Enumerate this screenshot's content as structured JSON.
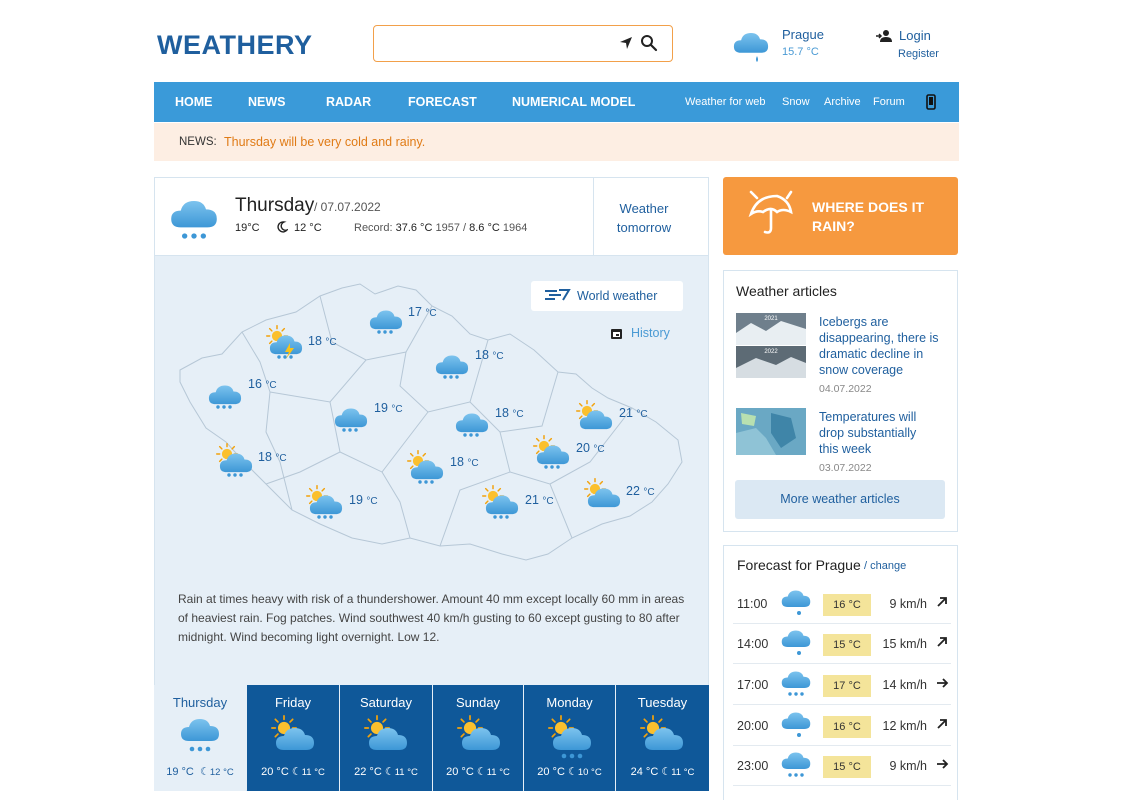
{
  "header": {
    "logo": "WEATHERY",
    "search_placeholder": "",
    "city": "Prague",
    "city_temp": "15.7 °C",
    "login": "Login",
    "register": "Register"
  },
  "nav": {
    "main": [
      "HOME",
      "NEWS",
      "RADAR",
      "FORECAST",
      "NUMERICAL MODEL"
    ],
    "secondary": [
      "Weather for web",
      "Snow",
      "Archive",
      "Forum"
    ]
  },
  "news": {
    "label": "NEWS:",
    "text": "Thursday will be very cold and rainy."
  },
  "today": {
    "day": "Thursday",
    "date": "/ 07.07.2022",
    "high": "19°C",
    "low": "12 °C",
    "record_label": "Record:",
    "record_high": "37.6 °C",
    "record_high_year": "1957 /",
    "record_low": "8.6 °C",
    "record_low_year": "1964",
    "tomorrow": "Weather tomorrow"
  },
  "map": {
    "world_weather": "World weather",
    "history": "History",
    "temps": [
      "17",
      "18",
      "18",
      "16",
      "19",
      "18",
      "21",
      "18",
      "18",
      "20",
      "19",
      "21",
      "22"
    ],
    "unit": "°C"
  },
  "description": "Rain at times heavy with risk of a thundershower. Amount 40 mm except locally 60 mm in areas of heaviest rain. Fog patches. Wind southwest 40 km/h gusting to 60 except gusting to 80 after midnight. Wind becoming light overnight. Low 12.",
  "days": [
    {
      "name": "Thursday",
      "hi": "19 °C",
      "lo": "12 °C",
      "icon": "rain-cloud-icon"
    },
    {
      "name": "Friday",
      "hi": "20 °C",
      "lo": "11 °C",
      "icon": "partly-cloudy-icon"
    },
    {
      "name": "Saturday",
      "hi": "22 °C",
      "lo": "11 °C",
      "icon": "partly-cloudy-icon"
    },
    {
      "name": "Sunday",
      "hi": "20 °C",
      "lo": "11 °C",
      "icon": "partly-cloudy-icon"
    },
    {
      "name": "Monday",
      "hi": "20 °C",
      "lo": "10 °C",
      "icon": "sun-rain-icon"
    },
    {
      "name": "Tuesday",
      "hi": "24 °C",
      "lo": "11 °C",
      "icon": "partly-cloudy-icon"
    }
  ],
  "rain_box": "WHERE DOES IT RAIN?",
  "articles": {
    "title": "Weather articles",
    "items": [
      {
        "title": "Icebergs are disappearing, there is dramatic decline in snow coverage",
        "date": "04.07.2022",
        "labels": [
          "2021",
          "2022"
        ]
      },
      {
        "title": "Temperatures will drop substantially this week",
        "date": "03.07.2022"
      }
    ],
    "more": "More weather articles"
  },
  "forecast": {
    "title": "Forecast for Prague",
    "change": "/ change",
    "rows": [
      {
        "time": "11:00",
        "temp": "16 °C",
        "wind": "9 km/h",
        "dir": "ne-arrow-icon"
      },
      {
        "time": "14:00",
        "temp": "15 °C",
        "wind": "15 km/h",
        "dir": "ne-arrow-icon"
      },
      {
        "time": "17:00",
        "temp": "17 °C",
        "wind": "14 km/h",
        "dir": "e-arrow-icon"
      },
      {
        "time": "20:00",
        "temp": "16 °C",
        "wind": "12 km/h",
        "dir": "ne-arrow-icon"
      },
      {
        "time": "23:00",
        "temp": "15 °C",
        "wind": "9 km/h",
        "dir": "e-arrow-icon"
      }
    ]
  },
  "colors": {
    "brand": "#1f5f9e",
    "nav": "#3a9ad9",
    "accent": "#f6993f",
    "dark_tile": "#0f5899"
  }
}
